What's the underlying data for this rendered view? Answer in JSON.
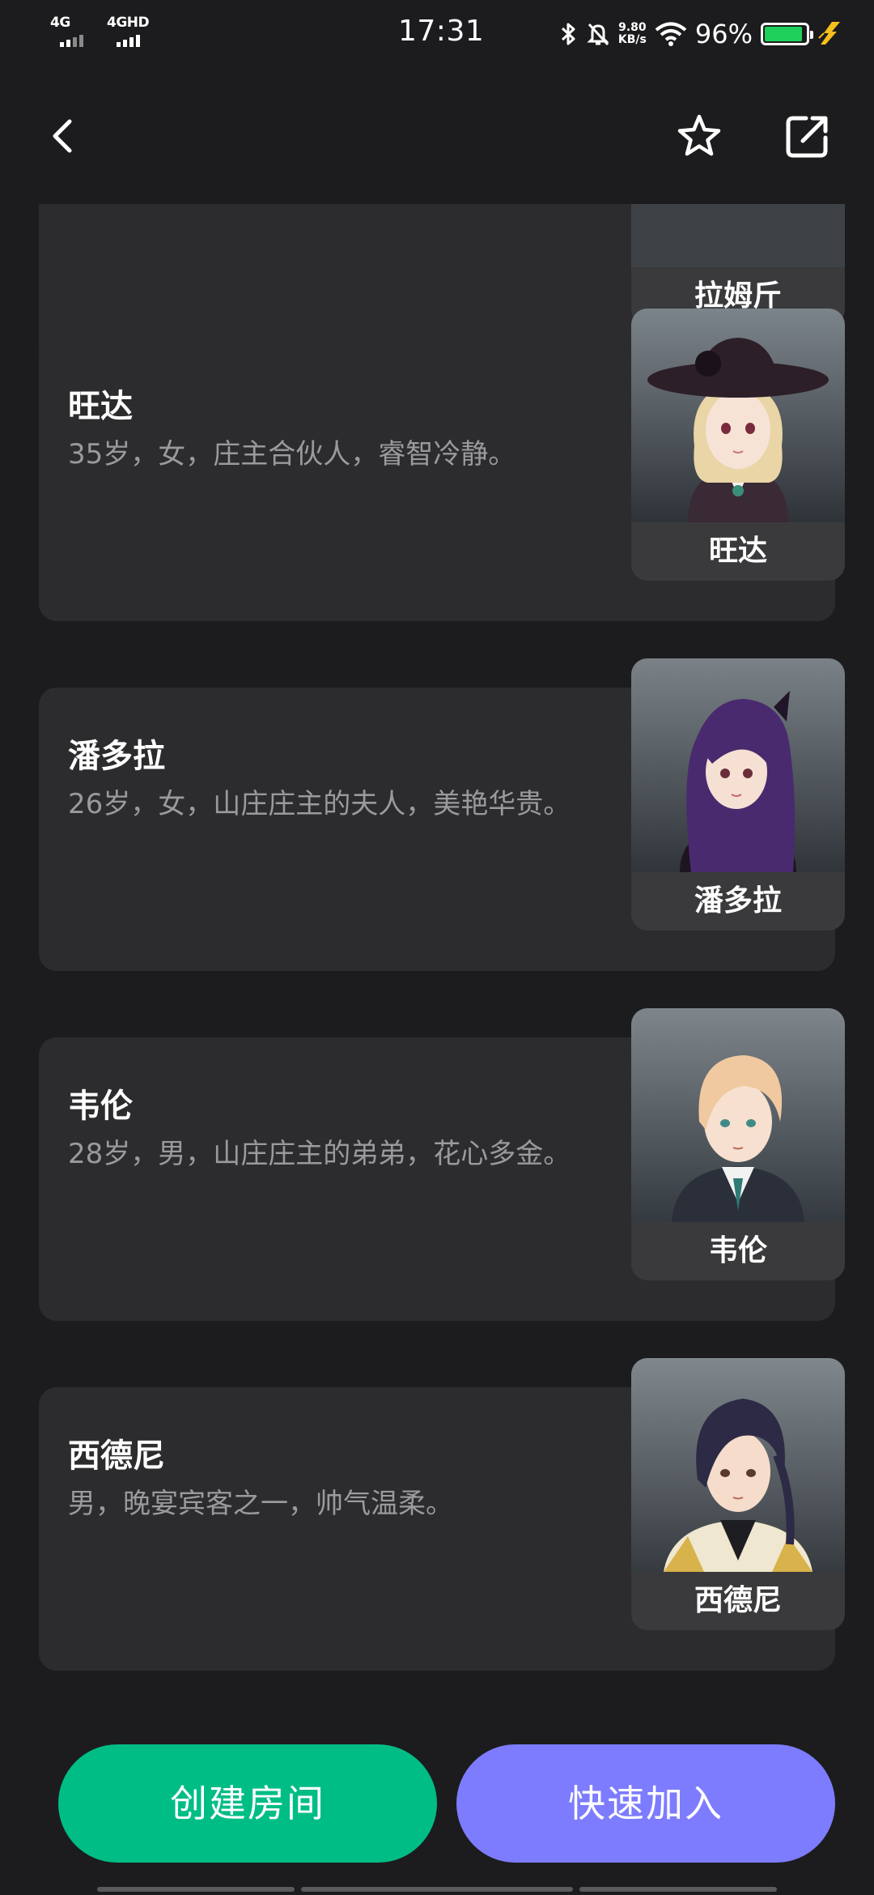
{
  "status_bar": {
    "network1": "4G",
    "network2": "4GHD",
    "time": "17:31",
    "speed_value": "9.80",
    "speed_unit": "KB/s",
    "battery_pct": "96%",
    "battery_level": 0.96,
    "battery_color": "#1fd15a",
    "icons": [
      "bluetooth-icon",
      "mute-icon",
      "wifi-icon",
      "battery-icon",
      "charging-icon"
    ]
  },
  "header": {
    "icons": [
      "back-icon",
      "star-icon",
      "share-icon"
    ]
  },
  "characters": [
    {
      "name": "拉姆斤",
      "desc": "",
      "portrait_label": "拉姆斤"
    },
    {
      "name": "旺达",
      "desc": "35岁，女，庄主合伙人，睿智冷静。",
      "portrait_label": "旺达",
      "hair_color": "#e9d5a6",
      "accent": "#3a2a35"
    },
    {
      "name": "潘多拉",
      "desc": "26岁，女，山庄庄主的夫人，美艳华贵。",
      "portrait_label": "潘多拉",
      "hair_color": "#4a2a6e",
      "accent": "#1d1520"
    },
    {
      "name": "韦伦",
      "desc": "28岁，男，山庄庄主的弟弟，花心多金。",
      "portrait_label": "韦伦",
      "hair_color": "#f0c9a0",
      "accent": "#2a2f3a"
    },
    {
      "name": "西德尼",
      "desc": "男，晚宴宾客之一，帅气温柔。",
      "portrait_label": "西德尼",
      "hair_color": "#2d2a45",
      "accent": "#efe7cf"
    }
  ],
  "actions": {
    "create_label": "创建房间",
    "join_label": "快速加入",
    "create_color": "#00bd86",
    "join_color": "#7d7cff"
  }
}
